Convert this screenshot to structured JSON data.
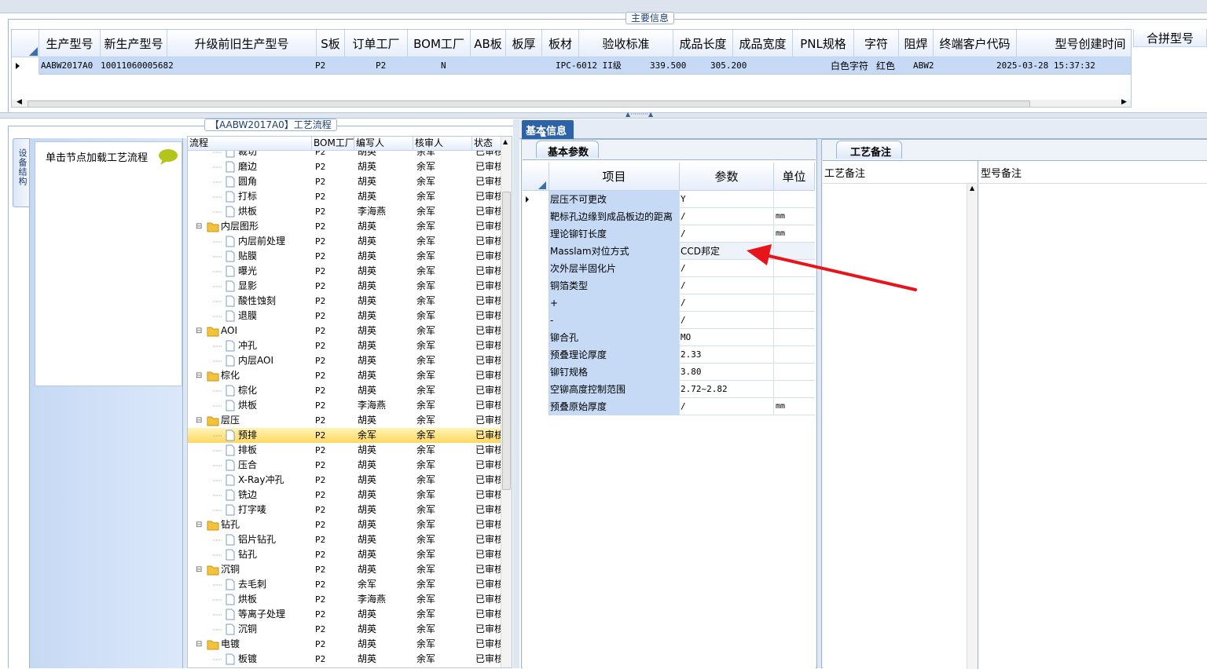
{
  "main": {
    "title": "主要信息",
    "columns": [
      "生产型号",
      "新生产型号",
      "升级前旧生产型号",
      "S板",
      "订单工厂",
      "BOM工厂",
      "AB板",
      "板厚",
      "板材",
      "验收标准",
      "成品长度",
      "成品宽度",
      "PNL规格",
      "字符",
      "阻焊",
      "终端客户代码",
      "型号创建时间"
    ],
    "row": {
      "model": "AABW2017A0",
      "new_model": "10011060005682",
      "order_factory": "P2",
      "bom_factory": "P2",
      "ab": "N",
      "standard": "IPC-6012 II级",
      "length": "339.500",
      "width": "305.200",
      "char": "白色字符",
      "mask": "红色",
      "customer": "ABW2",
      "created": "2025-03-28 15:37:32"
    },
    "side_header": "合拼型号"
  },
  "process": {
    "title": "【AABW2017A0】工艺流程",
    "left_tab": "设备结构",
    "hint": "单击节点加载工艺流程",
    "columns": [
      "流程",
      "BOM工厂",
      "编写人",
      "核审人",
      "状态"
    ],
    "rows": [
      {
        "name": "裁切",
        "lvl": 2,
        "bom": "P2",
        "writer": "胡英",
        "checker": "余军",
        "status": "已审核"
      },
      {
        "name": "磨边",
        "lvl": 2,
        "bom": "P2",
        "writer": "胡英",
        "checker": "余军",
        "status": "已审核"
      },
      {
        "name": "圆角",
        "lvl": 2,
        "bom": "P2",
        "writer": "胡英",
        "checker": "余军",
        "status": "已审核"
      },
      {
        "name": "打标",
        "lvl": 2,
        "bom": "P2",
        "writer": "胡英",
        "checker": "余军",
        "status": "已审核"
      },
      {
        "name": "烘板",
        "lvl": 2,
        "bom": "P2",
        "writer": "李海燕",
        "checker": "余军",
        "status": "已审核"
      },
      {
        "name": "内层图形",
        "lvl": 1,
        "bom": "P2",
        "writer": "胡英",
        "checker": "余军",
        "status": "已审核"
      },
      {
        "name": "内层前处理",
        "lvl": 2,
        "bom": "P2",
        "writer": "胡英",
        "checker": "余军",
        "status": "已审核"
      },
      {
        "name": "贴膜",
        "lvl": 2,
        "bom": "P2",
        "writer": "胡英",
        "checker": "余军",
        "status": "已审核"
      },
      {
        "name": "曝光",
        "lvl": 2,
        "bom": "P2",
        "writer": "胡英",
        "checker": "余军",
        "status": "已审核"
      },
      {
        "name": "显影",
        "lvl": 2,
        "bom": "P2",
        "writer": "胡英",
        "checker": "余军",
        "status": "已审核"
      },
      {
        "name": "酸性蚀刻",
        "lvl": 2,
        "bom": "P2",
        "writer": "胡英",
        "checker": "余军",
        "status": "已审核"
      },
      {
        "name": "退膜",
        "lvl": 2,
        "bom": "P2",
        "writer": "胡英",
        "checker": "余军",
        "status": "已审核"
      },
      {
        "name": "AOI",
        "lvl": 1,
        "bom": "P2",
        "writer": "胡英",
        "checker": "余军",
        "status": "已审核"
      },
      {
        "name": "冲孔",
        "lvl": 2,
        "bom": "P2",
        "writer": "胡英",
        "checker": "余军",
        "status": "已审核"
      },
      {
        "name": "内层AOI",
        "lvl": 2,
        "bom": "P2",
        "writer": "胡英",
        "checker": "余军",
        "status": "已审核"
      },
      {
        "name": "棕化",
        "lvl": 1,
        "bom": "P2",
        "writer": "胡英",
        "checker": "余军",
        "status": "已审核"
      },
      {
        "name": "棕化",
        "lvl": 2,
        "bom": "P2",
        "writer": "胡英",
        "checker": "余军",
        "status": "已审核"
      },
      {
        "name": "烘板",
        "lvl": 2,
        "bom": "P2",
        "writer": "李海燕",
        "checker": "余军",
        "status": "已审核"
      },
      {
        "name": "层压",
        "lvl": 1,
        "bom": "P2",
        "writer": "胡英",
        "checker": "余军",
        "status": "已审核"
      },
      {
        "name": "预排",
        "lvl": 2,
        "bom": "P2",
        "writer": "余军",
        "checker": "余军",
        "status": "已审核",
        "sel": true
      },
      {
        "name": "排板",
        "lvl": 2,
        "bom": "P2",
        "writer": "胡英",
        "checker": "余军",
        "status": "已审核"
      },
      {
        "name": "压合",
        "lvl": 2,
        "bom": "P2",
        "writer": "胡英",
        "checker": "余军",
        "status": "已审核"
      },
      {
        "name": "X-Ray冲孔",
        "lvl": 2,
        "bom": "P2",
        "writer": "胡英",
        "checker": "余军",
        "status": "已审核"
      },
      {
        "name": "铣边",
        "lvl": 2,
        "bom": "P2",
        "writer": "胡英",
        "checker": "余军",
        "status": "已审核"
      },
      {
        "name": "打字唛",
        "lvl": 2,
        "bom": "P2",
        "writer": "胡英",
        "checker": "余军",
        "status": "已审核"
      },
      {
        "name": "钻孔",
        "lvl": 1,
        "bom": "P2",
        "writer": "胡英",
        "checker": "余军",
        "status": "已审核"
      },
      {
        "name": "铝片钻孔",
        "lvl": 2,
        "bom": "P2",
        "writer": "胡英",
        "checker": "余军",
        "status": "已审核"
      },
      {
        "name": "钻孔",
        "lvl": 2,
        "bom": "P2",
        "writer": "胡英",
        "checker": "余军",
        "status": "已审核"
      },
      {
        "name": "沉铜",
        "lvl": 1,
        "bom": "P2",
        "writer": "胡英",
        "checker": "余军",
        "status": "已审核"
      },
      {
        "name": "去毛刺",
        "lvl": 2,
        "bom": "P2",
        "writer": "余军",
        "checker": "余军",
        "status": "已审核"
      },
      {
        "name": "烘板",
        "lvl": 2,
        "bom": "P2",
        "writer": "李海燕",
        "checker": "余军",
        "status": "已审核"
      },
      {
        "name": "等离子处理",
        "lvl": 2,
        "bom": "P2",
        "writer": "胡英",
        "checker": "余军",
        "status": "已审核"
      },
      {
        "name": "沉铜",
        "lvl": 2,
        "bom": "P2",
        "writer": "胡英",
        "checker": "余军",
        "status": "已审核"
      },
      {
        "name": "电镀",
        "lvl": 1,
        "bom": "P2",
        "writer": "胡英",
        "checker": "余军",
        "status": "已审核"
      },
      {
        "name": "板镀",
        "lvl": 2,
        "bom": "P2",
        "writer": "胡英",
        "checker": "余军",
        "status": "已审核"
      }
    ]
  },
  "basic": {
    "title": "基本信息",
    "params_tab": "基本参数",
    "columns": [
      "项目",
      "参数",
      "单位"
    ],
    "rows": [
      {
        "item": "层压不可更改",
        "param": "Y",
        "unit": ""
      },
      {
        "item": "靶标孔边缘到成品板边的距离",
        "param": "/",
        "unit": "mm"
      },
      {
        "item": "理论铆钉长度",
        "param": "/",
        "unit": "mm"
      },
      {
        "item": "Masslam对位方式",
        "param": "CCD邦定",
        "unit": ""
      },
      {
        "item": "次外层半固化片",
        "param": "/",
        "unit": ""
      },
      {
        "item": "铜箔类型",
        "param": "/",
        "unit": ""
      },
      {
        "item": "+",
        "param": "/",
        "unit": ""
      },
      {
        "item": "-",
        "param": "/",
        "unit": ""
      },
      {
        "item": "铆合孔",
        "param": "MO",
        "unit": ""
      },
      {
        "item": "预叠理论厚度",
        "param": "2.33",
        "unit": ""
      },
      {
        "item": "铆钉规格",
        "param": "3.80",
        "unit": ""
      },
      {
        "item": "空铆高度控制范围",
        "param": "2.72~2.82",
        "unit": ""
      },
      {
        "item": "预叠原始厚度",
        "param": "/",
        "unit": "mm"
      }
    ],
    "remarks_tab": "工艺备注",
    "remark_cols": [
      "工艺备注",
      "型号备注"
    ]
  },
  "colors": {
    "arrow": "#e8141c",
    "accent": "#1a4a8f",
    "selection": "#ffe88a",
    "header_bg": "#e6eefb"
  }
}
